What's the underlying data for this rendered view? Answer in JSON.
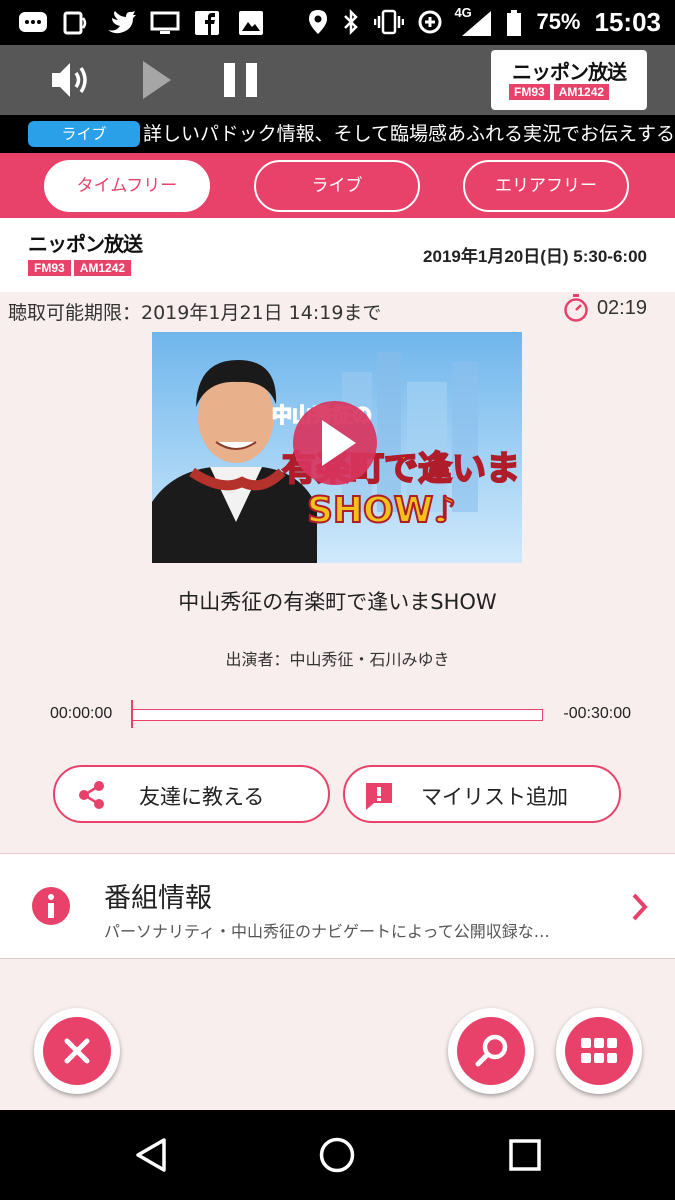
{
  "status_bar": {
    "battery": "75%",
    "time": "15:03",
    "network": "4G",
    "icons_left": [
      "messages-icon",
      "nfc-icon",
      "twitter-icon",
      "cast-icon",
      "facebook-icon",
      "gallery-icon"
    ],
    "icons_right": [
      "location-icon",
      "bluetooth-icon",
      "vibrate-icon",
      "data-saver-icon",
      "signal-icon",
      "battery-icon"
    ]
  },
  "player": {
    "volume_icon": "volume-icon",
    "play_icon": "play-icon",
    "pause_icon": "pause-icon"
  },
  "station_logo": {
    "name": "ニッポン放送",
    "fm": "FM93",
    "am": "AM1242"
  },
  "ticker": {
    "badge": "ライブ",
    "text": "詳しいパドック情報、そして臨場感あふれる実況でお伝えするレ"
  },
  "tabs": [
    {
      "label": "タイムフリー",
      "active": true
    },
    {
      "label": "ライブ",
      "active": false
    },
    {
      "label": "エリアフリー",
      "active": false
    }
  ],
  "program": {
    "date": "2019年1月20日(日) 5:30-6:00",
    "listen_limit": "聴取可能期限：2019年1月21日 14:19まで",
    "remaining": "02:19",
    "thumbnail_text": [
      "中山秀征の",
      "有楽町で逢いま",
      "SHOW♪"
    ],
    "title": "中山秀征の有楽町で逢いまSHOW",
    "performers": "出演者：中山秀征・石川みゆき",
    "time_start": "00:00:00",
    "time_end": "-00:30:00",
    "progress": 0
  },
  "actions": {
    "share_label": "友達に教える",
    "mylist_label": "マイリスト追加"
  },
  "info": {
    "title": "番組情報",
    "description": "パーソナリティ・中山秀征のナビゲートによって公開収録な…"
  },
  "colors": {
    "accent": "#e8426a",
    "ticker_badge": "#2aa0e8",
    "player_bar": "#575757"
  }
}
